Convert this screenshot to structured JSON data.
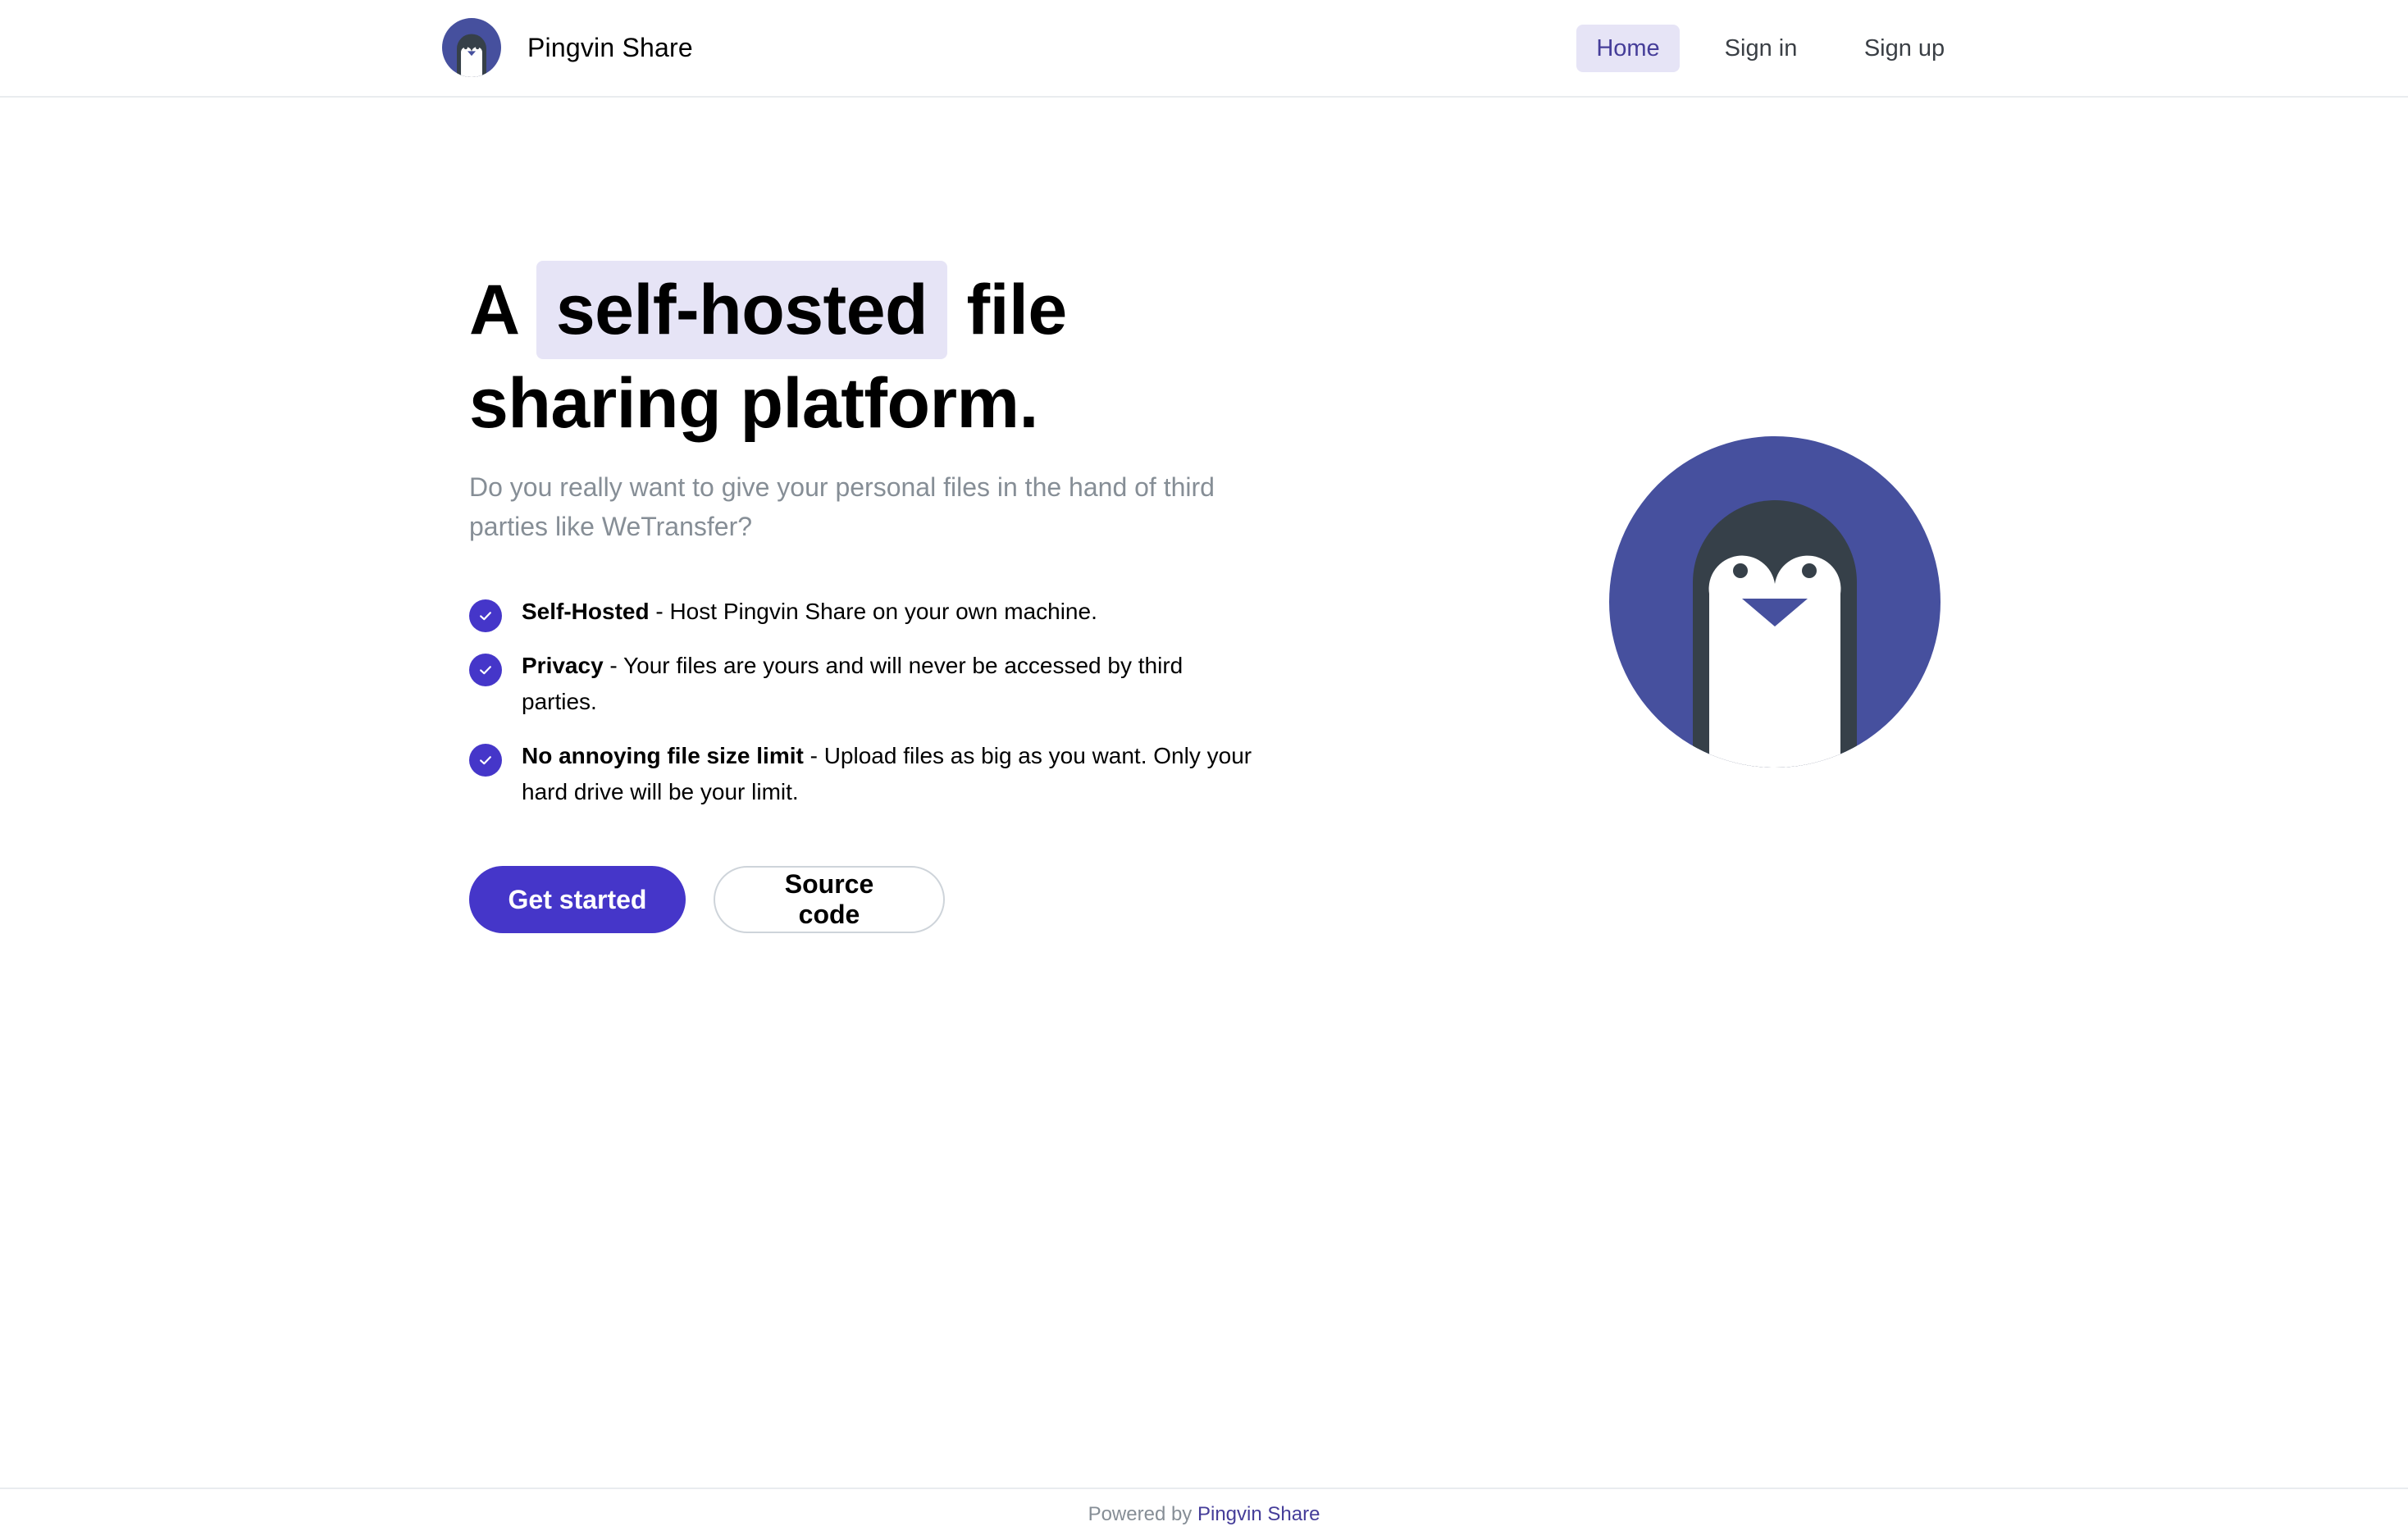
{
  "header": {
    "brand_name": "Pingvin Share",
    "nav": {
      "home": "Home",
      "sign_in": "Sign in",
      "sign_up": "Sign up"
    }
  },
  "hero": {
    "title_prefix": "A",
    "title_highlight": "self-hosted",
    "title_suffix": "file sharing platform.",
    "description": "Do you really want to give your personal files in the hand of third parties like WeTransfer?",
    "features": [
      {
        "title": "Self-Hosted",
        "text": " - Host Pingvin Share on your own machine."
      },
      {
        "title": "Privacy",
        "text": " - Your files are yours and will never be accessed by third parties."
      },
      {
        "title": "No annoying file size limit",
        "text": " - Upload files as big as you want. Only your hard drive will be your limit."
      }
    ],
    "buttons": {
      "primary": "Get started",
      "secondary": "Source code"
    }
  },
  "footer": {
    "prefix": "Powered by",
    "link": "Pingvin Share"
  },
  "icons": {
    "logo": "penguin-logo-icon",
    "check": "check-icon",
    "illustration": "penguin-illustration"
  },
  "colors": {
    "accent": "#4536c9",
    "highlight_bg": "#e6e4f6",
    "penguin_circle": "#46509e",
    "penguin_body": "#364049",
    "muted_text": "#868e96"
  }
}
